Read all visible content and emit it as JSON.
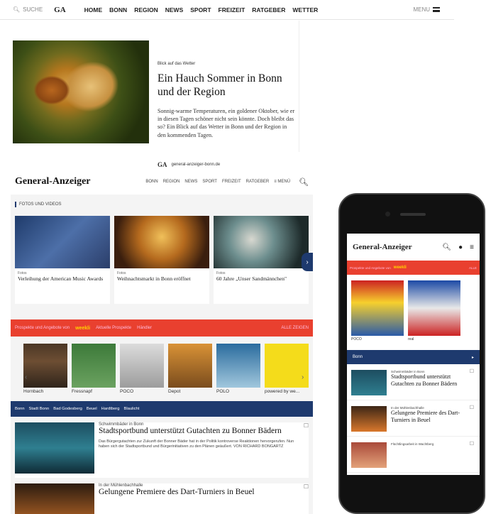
{
  "topbar": {
    "search_label": "SUCHE",
    "logo": "GA",
    "nav": [
      "HOME",
      "BONN",
      "REGION",
      "NEWS",
      "SPORT",
      "FREIZEIT",
      "RATGEBER",
      "WETTER"
    ],
    "menu_label": "MENU"
  },
  "teaser": {
    "kicker": "Blick auf das Wetter",
    "title": "Ein Hauch Sommer in Bonn und der Region",
    "text": "Sonnig-warme Temperaturen, ein goldener Oktober, wie er in diesen Tagen schöner nicht sein könnte. Doch bleibt das so? Ein Blick auf das Wetter in Bonn und der Region in den kommenden Tagen.",
    "source_logo": "GA",
    "source": "general-anzeiger-bonn.de"
  },
  "desktop": {
    "logo": "General-Anzeiger",
    "nav": [
      "BONN",
      "REGION",
      "NEWS",
      "SPORT",
      "FREIZEIT",
      "RATGEBER",
      "≡ MENÜ"
    ],
    "section_title": "FOTOS UND VIDEOS",
    "photos": [
      {
        "kicker": "Fotos",
        "title": "Verleihung der American Music Awards"
      },
      {
        "kicker": "Fotos",
        "title": "Weihnachtsmarkt in Bonn eröffnet"
      },
      {
        "kicker": "Fotos",
        "title": "60 Jahre „Unser Sandmännchen\""
      }
    ],
    "red_bar": {
      "left": "Prospekte und Angebote von",
      "brand": "weekli",
      "mid1": "Aktuelle Prospekte",
      "mid2": "Händler",
      "right": "ALLE ZEIGEN"
    },
    "prospekte": [
      "Hornbach",
      "Fressnapf",
      "POCO",
      "Depot",
      "POLO",
      "powered by we..."
    ],
    "blue_bar": [
      "Bonn",
      "Stadt Bonn",
      "Bad Godesberg",
      "Beuel",
      "Hardtberg",
      "Blaulicht"
    ],
    "articles": [
      {
        "kicker": "Schwimmbäder in Bonn",
        "title": "Stadtsportbund unterstützt Gutachten zu Bonner Bädern",
        "text": "Das Bürgergutachten zur Zukunft der Bonner Bäder hat in der Politik kontroverse Reaktionen hervorgerufen. Nun haben sich der Stadtsportbund und Bürgerinitiativen zu den Plänen geäußert. VON RICHARD BONGARTZ"
      },
      {
        "kicker": "In der Mühlenbachhalle",
        "title": "Gelungene Premiere des Dart-Turniers in Beuel",
        "text": ""
      }
    ]
  },
  "phone": {
    "logo": "General-Anzeiger",
    "red_bar": {
      "left": "Prospekte und Angebote von",
      "brand": "weekli",
      "right": "ALLE"
    },
    "prospekte": [
      "POCO",
      "real"
    ],
    "section": "Bonn",
    "articles": [
      {
        "kicker": "Schwimmbäder in Bonn",
        "title": "Stadtsportbund unterstützt Gutachten zu Bonner Bädern"
      },
      {
        "kicker": "In der Mühlenbachhalle",
        "title": "Gelungene Premiere des Dart-Turniers in Beuel"
      },
      {
        "kicker": "Flüchtlingsarbeit in Wachtberg",
        "title": ""
      }
    ]
  }
}
